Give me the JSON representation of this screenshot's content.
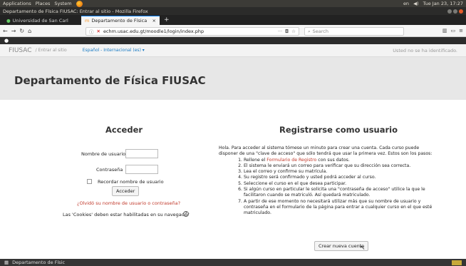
{
  "os_topbar": {
    "applications": "Applications",
    "places": "Places",
    "system": "System",
    "tray_lang": "en",
    "clock": "Tue Jan 23, 17:27"
  },
  "window": {
    "title": "Departamento de Física FIUSAC: Entrar al sitio - Mozilla Firefox"
  },
  "tabs": [
    {
      "label": "Universidad de San Carl",
      "close": "×"
    },
    {
      "label": "Departamento de Física",
      "close": "×"
    }
  ],
  "navbar": {
    "url": "echm.usac.edu.gt/moodle1/login/index.php",
    "url_domain": "usac.edu.gt",
    "search_placeholder": "Search",
    "more": "···"
  },
  "moodle_nav": {
    "brand": "FIUSAC",
    "breadcrumb": "/ Entrar al sitio",
    "language": "Español - Internacional (es) ▾",
    "login_status": "Usted no se ha identificado."
  },
  "page": {
    "title": "Departamento de Física FIUSAC"
  },
  "login": {
    "heading": "Acceder",
    "username_label": "Nombre de usuario",
    "password_label": "Contraseña",
    "remember_label": "Recordar nombre de usuario",
    "submit": "Acceder",
    "forgot": "¿Olvidó su nombre de usuario o contraseña?",
    "cookies": "Las 'Cookies' deben estar habilitadas en su navegador",
    "help": "?"
  },
  "signup": {
    "heading": "Registrarse como usuario",
    "intro": "Hola. Para acceder al sistema tómese un minuto para crear una cuenta. Cada curso puede disponer de una \"clave de acceso\" que sólo tendrá que usar la primera vez. Estos son los pasos:",
    "step1_pre": "Rellene el ",
    "step1_link": "Formulario de Registro",
    "step1_post": " con sus datos.",
    "steps": [
      "El sistema le enviará un correo para verificar que su dirección sea correcta.",
      "Lea el correo y confirme su matrícula.",
      "Su registro será confirmado y usted podrá acceder al curso.",
      "Seleccione el curso en el que desea participar.",
      "Si algún curso en particular le solicita una \"contraseña de acceso\" utilice la que le facilitaron cuando se matriculó. Así quedará matriculado.",
      "A partir de ese momento no necesitará utilizar más que su nombre de usuario y contraseña en el formulario de la página para entrar a cualquier curso en el que esté matriculado."
    ],
    "button": "Crear nueva cuenta"
  },
  "taskbar": {
    "item": "Departamento de Físic"
  },
  "colors": {
    "link": "#c0392b",
    "lang_link": "#1a7bc4",
    "os_bar": "#3c3b37",
    "accent": "#0a84ff"
  }
}
